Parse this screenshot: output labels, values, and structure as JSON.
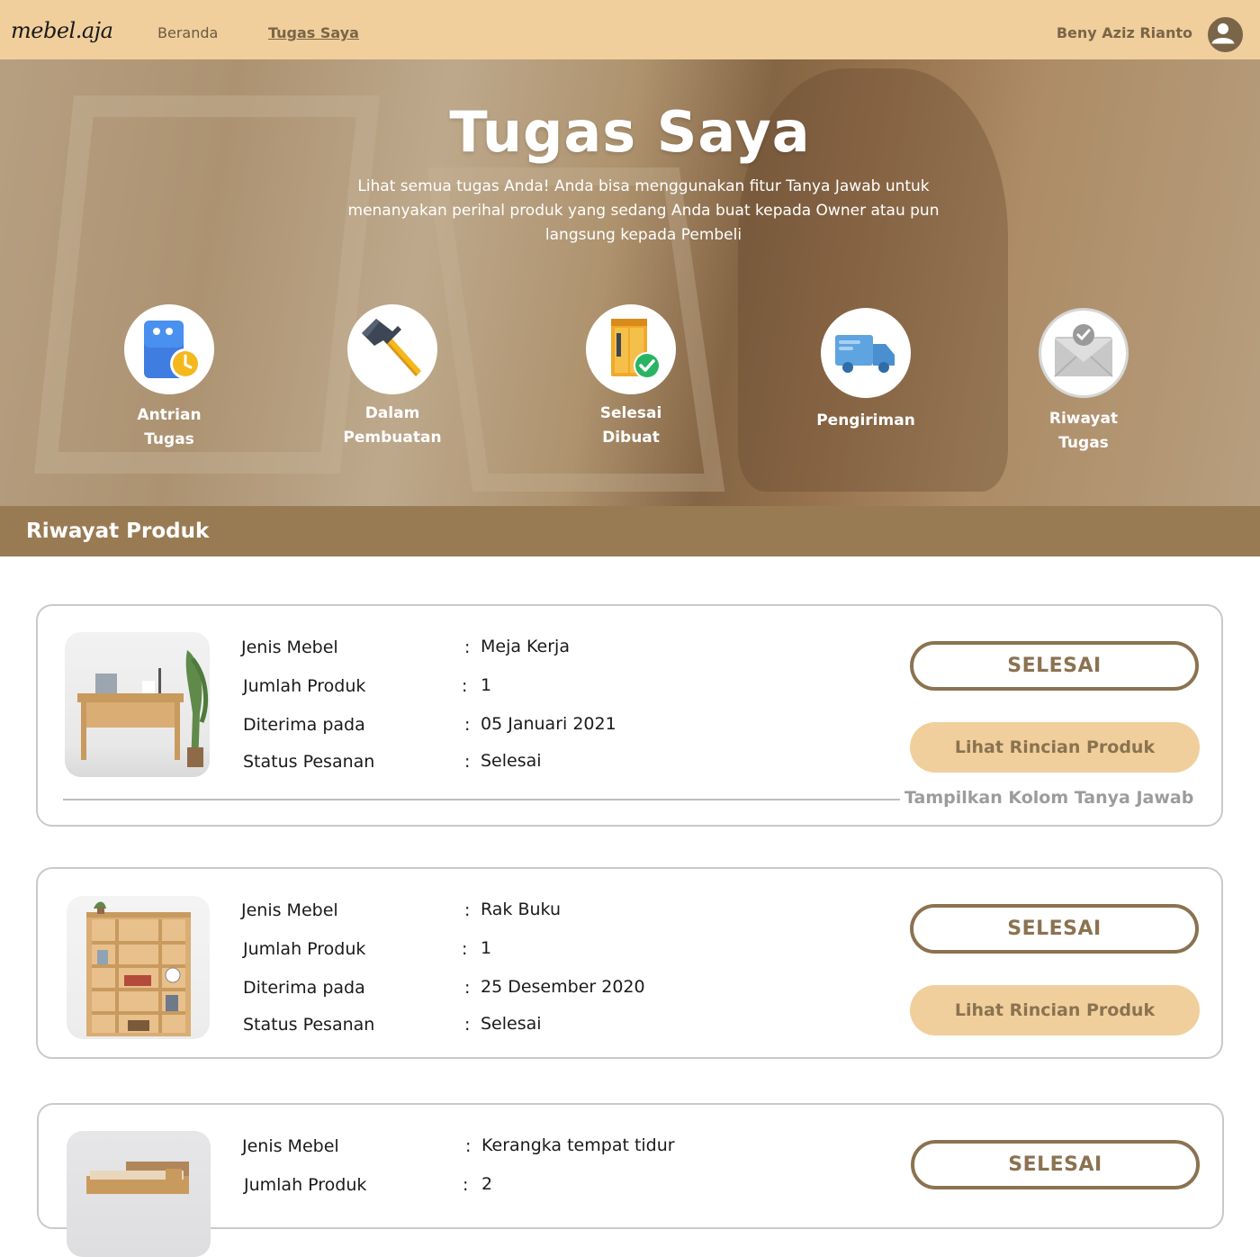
{
  "navbar": {
    "logo": "mebel.aja",
    "links": [
      {
        "label": "Beranda"
      },
      {
        "label": "Tugas Saya"
      }
    ],
    "user_name": "Beny Aziz Rianto"
  },
  "hero": {
    "title": "Tugas Saya",
    "description": "Lihat semua tugas Anda! Anda bisa menggunakan fitur Tanya Jawab untuk menanyakan perihal produk yang sedang Anda buat kepada Owner atau pun langsung kepada Pembeli",
    "categories": [
      {
        "line1": "Antrian",
        "line2": "Tugas",
        "icon": "queue-clock-icon"
      },
      {
        "line1": "Dalam",
        "line2": "Pembuatan",
        "icon": "hammer-icon"
      },
      {
        "line1": "Selesai",
        "line2": "Dibuat",
        "icon": "cabinet-check-icon"
      },
      {
        "line1": "Pengiriman",
        "line2": "",
        "icon": "delivery-truck-icon"
      },
      {
        "line1": "Riwayat",
        "line2": "Tugas",
        "icon": "mail-check-icon"
      }
    ]
  },
  "section": {
    "title": "Riwayat Produk"
  },
  "products": [
    {
      "labels": {
        "jenis": "Jenis Mebel",
        "jumlah": "Jumlah Produk",
        "diterima": "Diterima pada",
        "status": "Status Pesanan"
      },
      "colon": ":",
      "jenis": "Meja Kerja",
      "jumlah": "1",
      "diterima": "05 Januari 2021",
      "status": "Selesai",
      "status_button": "SELESAI",
      "detail_button": "Lihat Rincian Produk",
      "qa_link": "Tampilkan Kolom Tanya Jawab",
      "image": "desk-image"
    },
    {
      "labels": {
        "jenis": "Jenis Mebel",
        "jumlah": "Jumlah Produk",
        "diterima": "Diterima pada",
        "status": "Status Pesanan"
      },
      "colon": ":",
      "jenis": "Rak Buku",
      "jumlah": "1",
      "diterima": "25 Desember 2020",
      "status": "Selesai",
      "status_button": "SELESAI",
      "detail_button": "Lihat Rincian Produk",
      "image": "bookshelf-image"
    },
    {
      "labels": {
        "jenis": "Jenis Mebel",
        "jumlah": "Jumlah Produk"
      },
      "colon": ":",
      "jenis": "Kerangka tempat tidur",
      "jumlah": "2",
      "status_button": "SELESAI",
      "image": "bed-frame-image"
    }
  ],
  "colors": {
    "navbar_bg": "#f0cf9c",
    "section_bg": "#997b53",
    "accent_brown": "#8b7250",
    "detail_button_bg": "#f0cf9c"
  }
}
